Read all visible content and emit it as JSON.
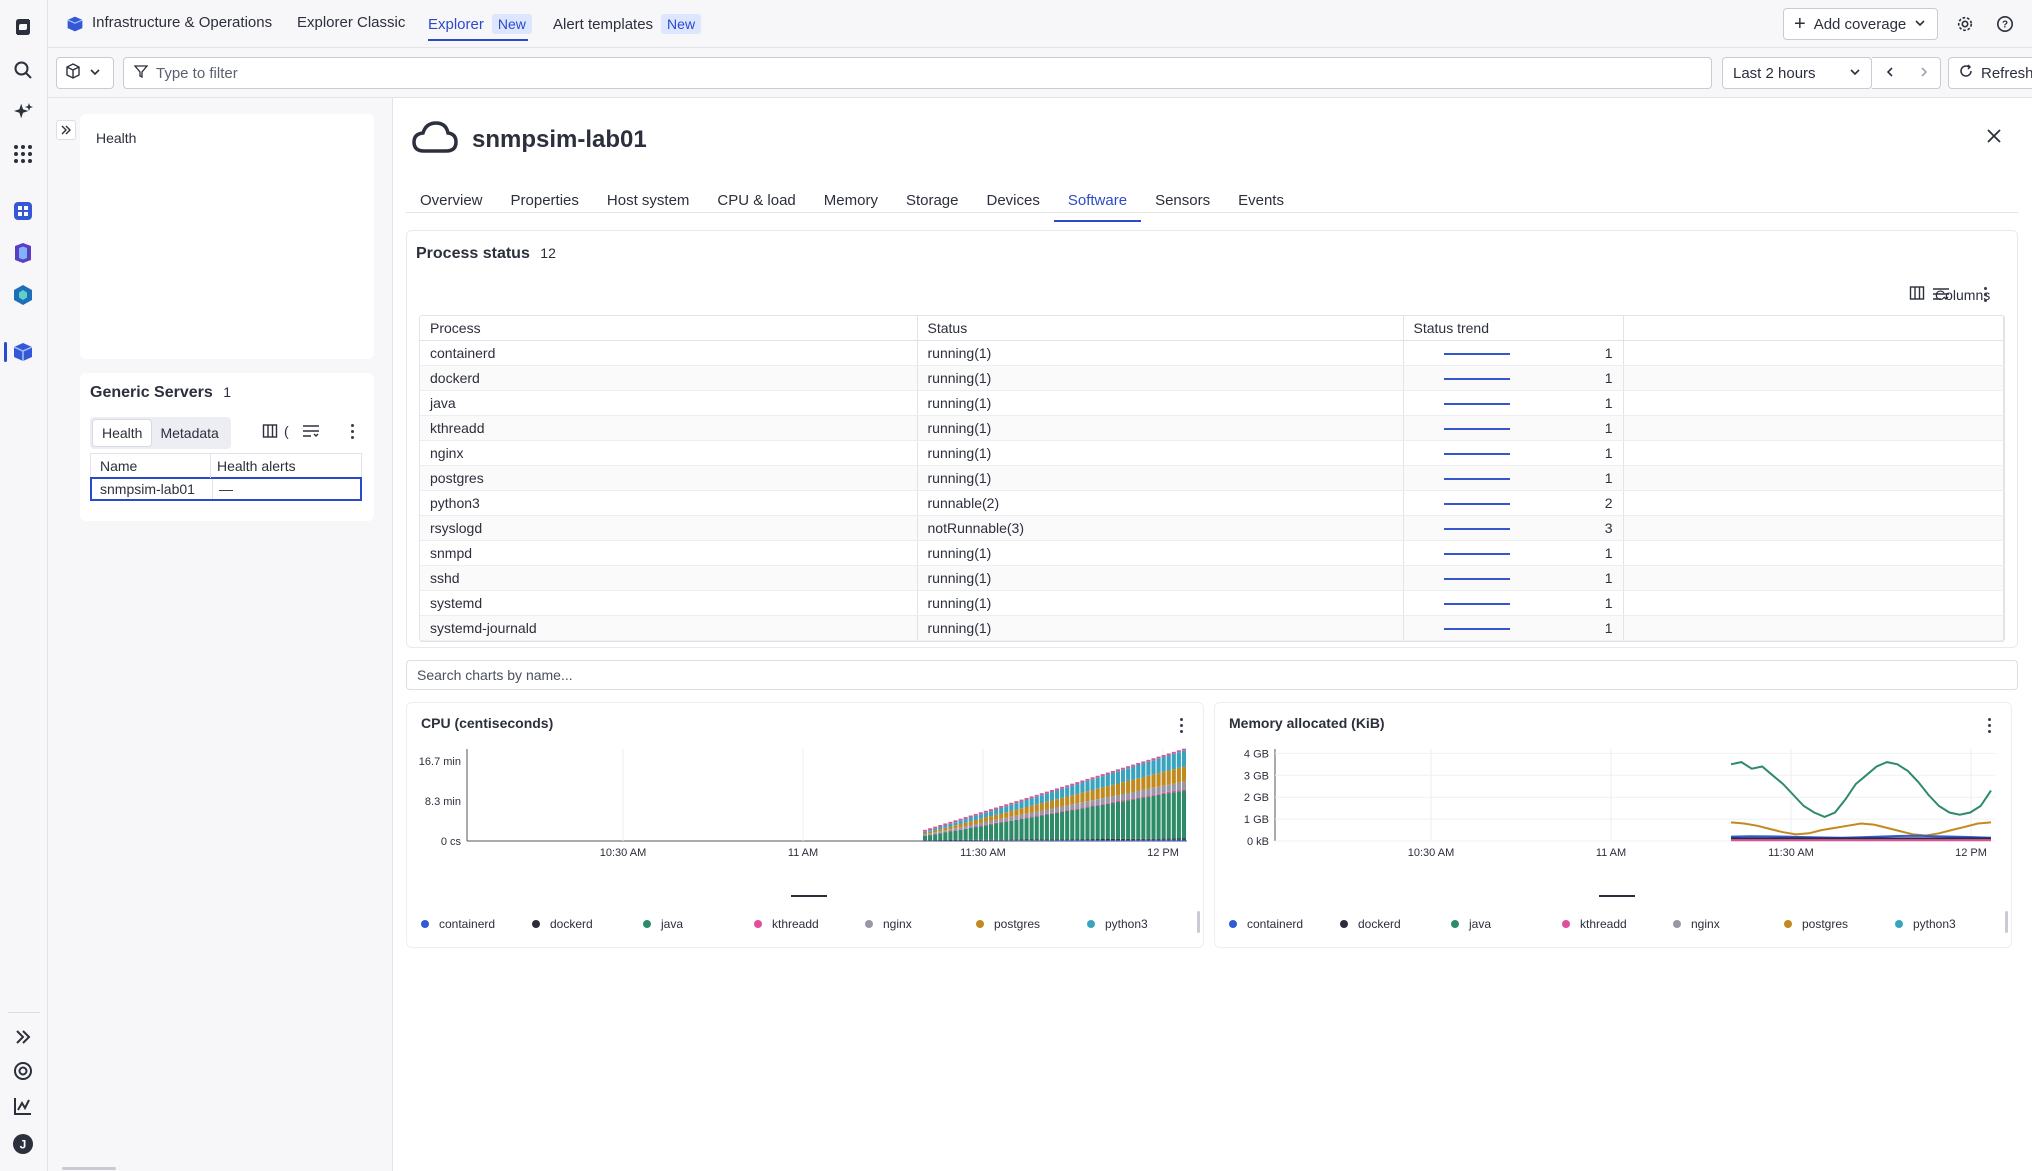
{
  "topnav": {
    "app_title": "Infrastructure & Operations",
    "tabs": [
      {
        "label": "Explorer Classic",
        "badge": ""
      },
      {
        "label": "Explorer",
        "badge": "New"
      },
      {
        "label": "Alert templates",
        "badge": "New"
      }
    ],
    "add_coverage": "Add coverage"
  },
  "filterbar": {
    "placeholder": "Type to filter",
    "timeframe": "Last 2 hours",
    "refresh": "Refresh"
  },
  "left": {
    "health_label": "Health",
    "group_title": "Generic Servers",
    "group_count": "1",
    "seg_health": "Health",
    "seg_metadata": "Metadata",
    "columns": [
      "Name",
      "Health alerts"
    ],
    "rows": [
      {
        "name": "snmpsim-lab01",
        "alerts": "—"
      }
    ]
  },
  "entity": {
    "name": "snmpsim-lab01",
    "tabs": [
      "Overview",
      "Properties",
      "Host system",
      "CPU & load",
      "Memory",
      "Storage",
      "Devices",
      "Software",
      "Sensors",
      "Events"
    ],
    "active_tab": "Software"
  },
  "process_status": {
    "title": "Process status",
    "count": "12",
    "columns_label": "Columns",
    "headers": [
      "Process",
      "Status",
      "Status trend"
    ],
    "rows": [
      {
        "process": "containerd",
        "status": "running(1)",
        "trend": "1"
      },
      {
        "process": "dockerd",
        "status": "running(1)",
        "trend": "1"
      },
      {
        "process": "java",
        "status": "running(1)",
        "trend": "1"
      },
      {
        "process": "kthreadd",
        "status": "running(1)",
        "trend": "1"
      },
      {
        "process": "nginx",
        "status": "running(1)",
        "trend": "1"
      },
      {
        "process": "postgres",
        "status": "running(1)",
        "trend": "1"
      },
      {
        "process": "python3",
        "status": "runnable(2)",
        "trend": "2"
      },
      {
        "process": "rsyslogd",
        "status": "notRunnable(3)",
        "trend": "3"
      },
      {
        "process": "snmpd",
        "status": "running(1)",
        "trend": "1"
      },
      {
        "process": "sshd",
        "status": "running(1)",
        "trend": "1"
      },
      {
        "process": "systemd",
        "status": "running(1)",
        "trend": "1"
      },
      {
        "process": "systemd-journald",
        "status": "running(1)",
        "trend": "1"
      }
    ]
  },
  "chart_search_placeholder": "Search charts by name...",
  "legend_colors": {
    "containerd": "#2f5bd8",
    "dockerd": "#2b2d3a",
    "java": "#2e8b68",
    "kthreadd": "#e0509a",
    "nginx": "#9a96a8",
    "postgres": "#c08a1e",
    "python3": "#3aa3c0"
  },
  "chart_data": [
    {
      "type": "area",
      "title": "CPU (centiseconds)",
      "x_ticks": [
        "10:30 AM",
        "11 AM",
        "11:30 AM",
        "12 PM"
      ],
      "y_ticks": [
        "0 cs",
        "8.3 min",
        "16.7 min"
      ],
      "ylim_minutes": [
        0,
        22
      ],
      "stacked": true,
      "series": [
        {
          "name": "containerd",
          "start_minutes": 0.1,
          "end_minutes": 0.3
        },
        {
          "name": "dockerd",
          "start_minutes": 0.1,
          "end_minutes": 0.3
        },
        {
          "name": "java",
          "start_minutes": 1.0,
          "end_minutes": 11.5
        },
        {
          "name": "kthreadd",
          "start_minutes": 0.1,
          "end_minutes": 0.3
        },
        {
          "name": "nginx",
          "start_minutes": 0.3,
          "end_minutes": 1.8
        },
        {
          "name": "postgres",
          "start_minutes": 0.3,
          "end_minutes": 3.6
        },
        {
          "name": "python3",
          "start_minutes": 0.3,
          "end_minutes": 3.8
        }
      ],
      "legend": [
        "containerd",
        "dockerd",
        "java",
        "kthreadd",
        "nginx",
        "postgres",
        "python3"
      ]
    },
    {
      "type": "line",
      "title": "Memory allocated (KiB)",
      "x_ticks": [
        "10:30 AM",
        "11 AM",
        "11:30 AM",
        "12 PM"
      ],
      "y_ticks": [
        "0 kB",
        "1 GB",
        "2 GB",
        "3 GB",
        "4 GB"
      ],
      "ylim_gb": [
        0,
        4.2
      ],
      "series": [
        {
          "name": "java",
          "values_gb": [
            3.5,
            3.6,
            3.3,
            3.4,
            3.0,
            2.6,
            2.1,
            1.6,
            1.3,
            1.1,
            1.3,
            1.9,
            2.6,
            3.0,
            3.4,
            3.6,
            3.5,
            3.2,
            2.7,
            2.1,
            1.6,
            1.3,
            1.2,
            1.3,
            1.6,
            2.3
          ]
        },
        {
          "name": "postgres",
          "values_gb": [
            0.85,
            0.8,
            0.7,
            0.55,
            0.4,
            0.3,
            0.35,
            0.5,
            0.6,
            0.7,
            0.8,
            0.75,
            0.6,
            0.45,
            0.3,
            0.25,
            0.35,
            0.5,
            0.65,
            0.8,
            0.85
          ]
        },
        {
          "name": "containerd",
          "values_gb": [
            0.2,
            0.22,
            0.21,
            0.2,
            0.18,
            0.16,
            0.15,
            0.17,
            0.2,
            0.23,
            0.24,
            0.22,
            0.2,
            0.18,
            0.15
          ]
        },
        {
          "name": "dockerd",
          "values_gb": [
            0.12,
            0.12,
            0.12,
            0.12,
            0.12,
            0.12,
            0.12,
            0.12,
            0.12,
            0.12,
            0.12,
            0.12,
            0.12,
            0.12,
            0.12
          ]
        },
        {
          "name": "kthreadd",
          "values_gb": [
            0.03,
            0.03,
            0.03,
            0.03,
            0.03,
            0.03,
            0.03,
            0.03,
            0.03,
            0.03,
            0.03,
            0.03,
            0.03,
            0.03,
            0.03
          ]
        }
      ],
      "legend": [
        "containerd",
        "dockerd",
        "java",
        "kthreadd",
        "nginx",
        "postgres",
        "python3"
      ]
    }
  ]
}
